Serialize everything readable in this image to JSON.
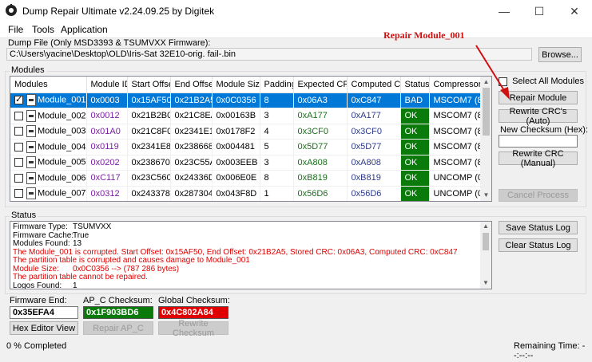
{
  "window": {
    "title": "Dump Repair Ultimate v2.24.09.25 by Digitek",
    "minimize": "—",
    "maximize": "☐",
    "close": "✕"
  },
  "menu": [
    "File",
    "Tools",
    "Application"
  ],
  "dump": {
    "label": "Dump File (Only MSD3393 & TSUMVXX Firmware):",
    "path": "C:\\Users\\yacine\\Desktop\\OLD\\Iris-Sat 32E10-orig. fail-.bin",
    "browse_label": "Browse..."
  },
  "modules": {
    "group_label": "Modules",
    "columns": [
      "Modules",
      "Module ID",
      "Start Offset",
      "End Offset",
      "Module Size",
      "Padding",
      "Expected CRC",
      "Computed CRC",
      "Status",
      "Compressor"
    ],
    "rows": [
      {
        "checked": true,
        "name": "Module_001",
        "id": "0x0003",
        "start": "0x15AF50",
        "end": "0x21B2A5",
        "size": "0x0C0356",
        "padding": "8",
        "expected": "0x06A3",
        "computed": "0xC847",
        "status": "BAD",
        "compressor": "MSCOM7 (8)"
      },
      {
        "checked": false,
        "name": "Module_002",
        "id": "0x0012",
        "start": "0x21B2B0",
        "end": "0x21C8EA",
        "size": "0x00163B",
        "padding": "3",
        "expected": "0xA177",
        "computed": "0xA177",
        "status": "OK",
        "compressor": "MSCOM7 (8)"
      },
      {
        "checked": false,
        "name": "Module_003",
        "id": "0x01A0",
        "start": "0x21C8F0",
        "end": "0x2341E1",
        "size": "0x0178F2",
        "padding": "4",
        "expected": "0x3CF0",
        "computed": "0x3CF0",
        "status": "OK",
        "compressor": "MSCOM7 (8)"
      },
      {
        "checked": false,
        "name": "Module_004",
        "id": "0x0119",
        "start": "0x2341E8",
        "end": "0x238668",
        "size": "0x004481",
        "padding": "5",
        "expected": "0x5D77",
        "computed": "0x5D77",
        "status": "OK",
        "compressor": "MSCOM7 (8)"
      },
      {
        "checked": false,
        "name": "Module_005",
        "id": "0x0202",
        "start": "0x238670",
        "end": "0x23C55A",
        "size": "0x003EEB",
        "padding": "3",
        "expected": "0xA808",
        "computed": "0xA808",
        "status": "OK",
        "compressor": "MSCOM7 (8)"
      },
      {
        "checked": false,
        "name": "Module_006",
        "id": "0xC117",
        "start": "0x23C560",
        "end": "0x24336D",
        "size": "0x006E0E",
        "padding": "8",
        "expected": "0xB819",
        "computed": "0xB819",
        "status": "OK",
        "compressor": "UNCOMP (0)"
      },
      {
        "checked": false,
        "name": "Module_007",
        "id": "0x0312",
        "start": "0x243378",
        "end": "0x287304",
        "size": "0x043F8D",
        "padding": "1",
        "expected": "0x56D6",
        "computed": "0x56D6",
        "status": "OK",
        "compressor": "UNCOMP (0)"
      }
    ],
    "select_all_label": "Select All Modules",
    "repair_label": "Repair Module",
    "rewrite_auto_label": "Rewrite CRC's (Auto)",
    "new_checksum_label": "New Checksum (Hex):",
    "new_checksum_value": "",
    "rewrite_manual_label": "Rewrite CRC (Manual)",
    "cancel_label": "Cancel Process"
  },
  "status": {
    "group_label": "Status",
    "lines": [
      {
        "key": "Firmware Type:",
        "value": "TSUMVXX",
        "red": false
      },
      {
        "key": "Firmware Cache:",
        "value": "True",
        "red": false
      },
      {
        "key": "Modules Found:",
        "value": "13",
        "red": false
      },
      {
        "key": "",
        "value": "The Module_001 is corrupted. Start Offset: 0x15AF50, End Offset: 0x21B2A5, Stored CRC: 0x06A3, Computed CRC: 0xC847",
        "red": true
      },
      {
        "key": "",
        "value": "The partition table is corrupted and causes damage to Module_001",
        "red": true
      },
      {
        "key": "Module Size:",
        "value": "0x0C0356 --> (787 286 bytes)",
        "red": true
      },
      {
        "key": "",
        "value": "The partition table cannot be repaired.",
        "red": true
      },
      {
        "key": "Logos Found:",
        "value": "1",
        "red": false
      }
    ],
    "save_label": "Save Status Log",
    "clear_label": "Clear Status Log"
  },
  "bottom": {
    "fw_end_label": "Firmware End:",
    "fw_end_value": "0x35EFA4",
    "apc_label": "AP_C Checksum:",
    "apc_value": "0x1F903BD6",
    "global_label": "Global Checksum:",
    "global_value": "0x4C802A84",
    "hex_editor_label": "Hex Editor View",
    "repair_apc_label": "Repair AP_C",
    "rewrite_checksum_label": "Rewrite Checksum"
  },
  "footer": {
    "progress_text": "0 % Completed",
    "remaining_text": "Remaining Time: --:--:--"
  },
  "annotation": {
    "text": "Repair Module_001"
  },
  "colors": {
    "selected": "#0078d7",
    "ok": "#0a7a0a",
    "bad": "#0078d7",
    "error_text": "#e00000",
    "apc_bg": "#0a7a0a",
    "global_bg": "#e00000"
  }
}
